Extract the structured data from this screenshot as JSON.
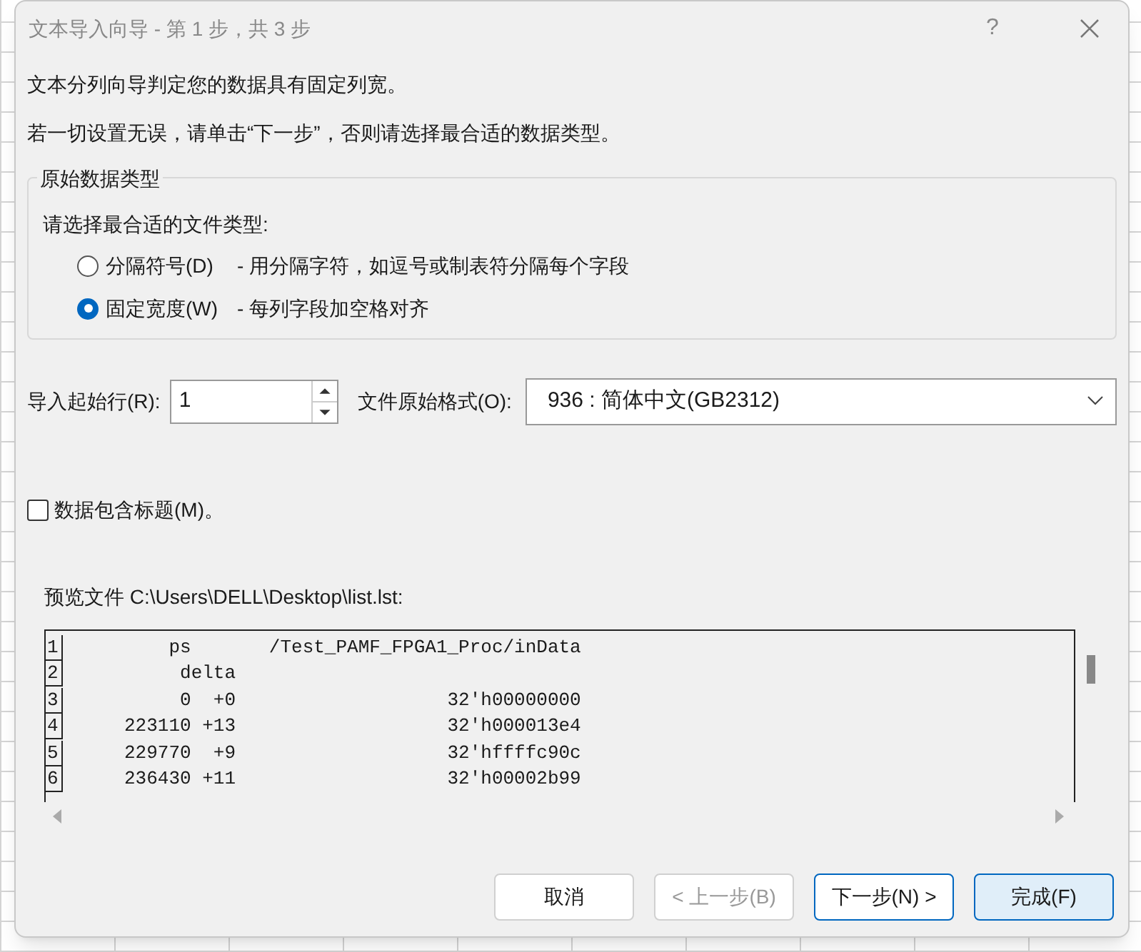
{
  "window": {
    "title": "文本导入向导 - 第 1 步，共 3 步",
    "help": "?"
  },
  "intro": [
    "文本分列向导判定您的数据具有固定列宽。",
    "若一切设置无误，请单击“下一步”，否则请选择最合适的数据类型。"
  ],
  "data_type": {
    "legend": "原始数据类型",
    "prompt": "请选择最合适的文件类型:",
    "options": [
      {
        "label": "分隔符号(D)",
        "description": "- 用分隔字符，如逗号或制表符分隔每个字段",
        "selected": false
      },
      {
        "label": "固定宽度(W)",
        "description": "- 每列字段加空格对齐",
        "selected": true
      }
    ]
  },
  "start_row": {
    "label": "导入起始行(R):",
    "value": "1"
  },
  "file_origin": {
    "label": "文件原始格式(O):",
    "value": "936 : 简体中文(GB2312)"
  },
  "header_checkbox": {
    "label": "数据包含标题(M)。",
    "checked": false
  },
  "preview": {
    "label": "预览文件 C:\\Users\\DELL\\Desktop\\list.lst:",
    "rows": [
      {
        "number": "1",
        "text": "         ps       /Test_PAMF_FPGA1_Proc/inData"
      },
      {
        "number": "2",
        "text": "          delta"
      },
      {
        "number": "3",
        "text": "          0  +0                   32'h00000000"
      },
      {
        "number": "4",
        "text": "     223110 +13                   32'h000013e4"
      },
      {
        "number": "5",
        "text": "     229770  +9                   32'hffffc90c"
      },
      {
        "number": "6",
        "text": "     236430 +11                   32'h00002b99"
      }
    ]
  },
  "buttons": [
    {
      "label": "取消",
      "kind": "plain",
      "disabled": false
    },
    {
      "label": "< 上一步(B)",
      "kind": "plain",
      "disabled": true
    },
    {
      "label": "下一步(N) >",
      "kind": "focused",
      "disabled": false
    },
    {
      "label": "完成(F)",
      "kind": "hover",
      "disabled": false
    }
  ]
}
